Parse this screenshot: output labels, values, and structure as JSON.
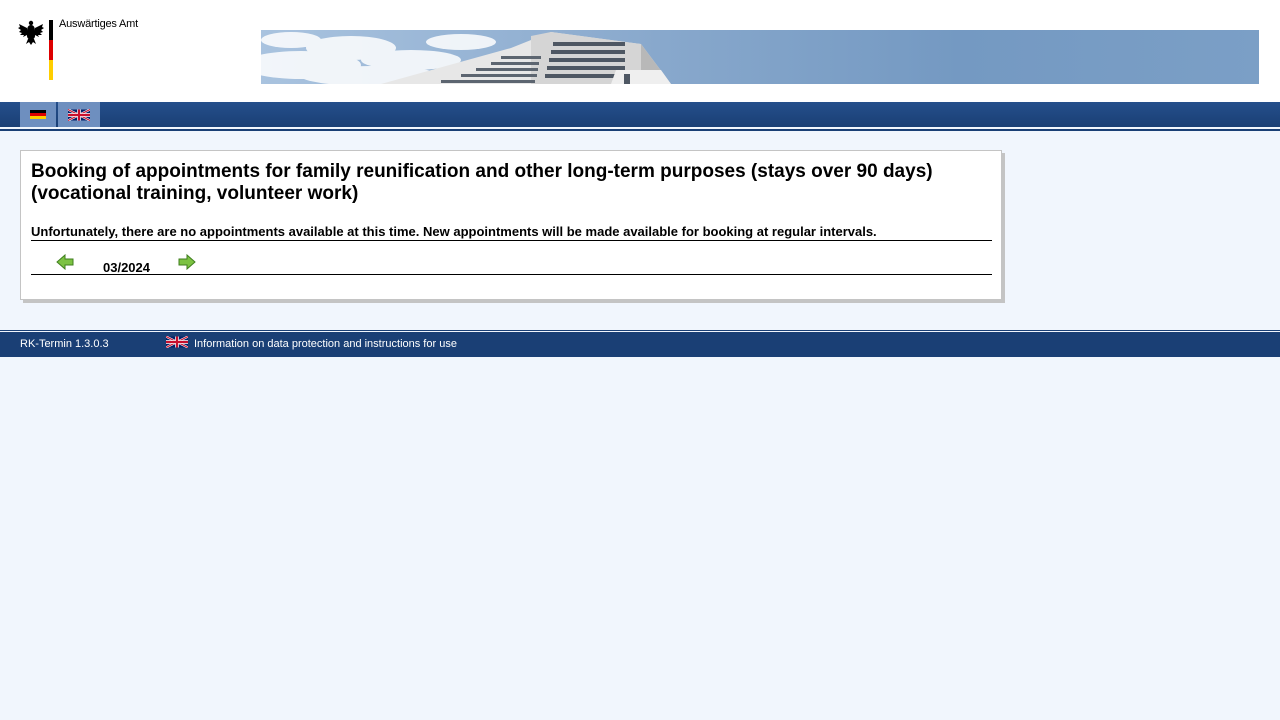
{
  "header": {
    "logo_text": "Auswärtiges Amt"
  },
  "language_switch": {
    "items": [
      {
        "code": "de",
        "icon": "german-flag-icon"
      },
      {
        "code": "en",
        "icon": "uk-flag-icon"
      }
    ]
  },
  "main": {
    "title": "Booking of appointments for family reunification and other long-term purposes (stays over 90 days) (vocational training, volunteer work)",
    "notice": "Unfortunately, there are no appointments available at this time. New appointments will be made available for booking at regular intervals.",
    "pager": {
      "month": "03/2024",
      "prev_icon": "arrow-left-icon",
      "next_icon": "arrow-right-icon"
    }
  },
  "footer": {
    "version": "RK-Termin 1.3.0.3",
    "link_text": "Information on data protection and instructions for use",
    "link_icon": "uk-flag-icon"
  },
  "colors": {
    "nav_blue": "#1a3f75",
    "page_background": "#f1f6fd",
    "arrow_green": "#6fb43f"
  }
}
